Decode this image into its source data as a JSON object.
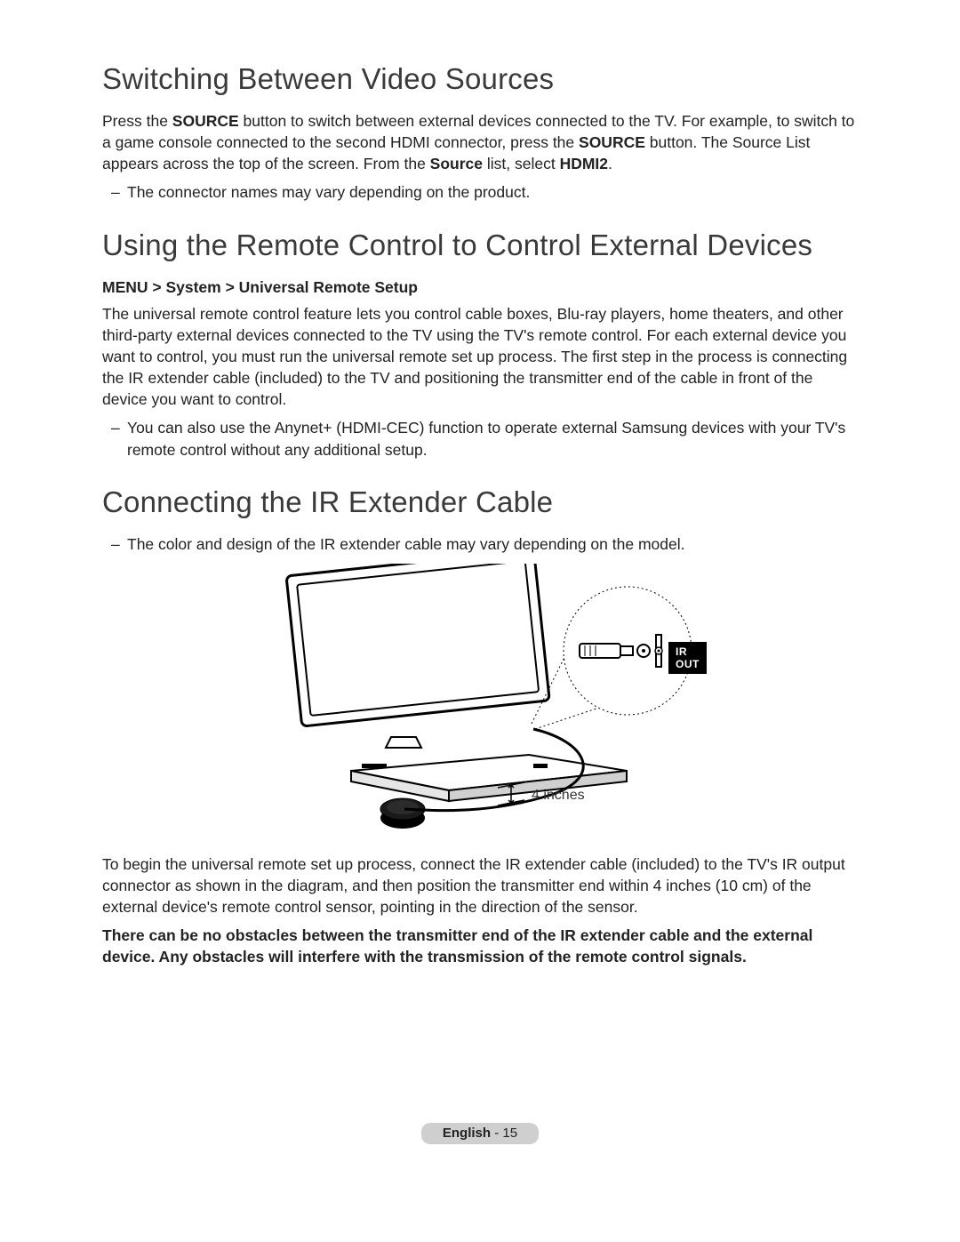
{
  "section1": {
    "heading": "Switching Between Video Sources",
    "para_pre": "Press the ",
    "para_bold1": "SOURCE",
    "para_mid1": " button to switch between external devices connected to the TV. For example, to switch to a game console connected to the second HDMI connector, press the ",
    "para_bold2": "SOURCE",
    "para_mid2": " button. The Source List appears across the top of the screen. From the ",
    "para_bold3": "Source",
    "para_mid3": " list, select ",
    "para_bold4": "HDMI2",
    "para_end": ".",
    "note1": "The connector names may vary depending on the product."
  },
  "section2": {
    "heading": "Using the Remote Control to Control External Devices",
    "menu_path": "MENU > System > Universal Remote Setup",
    "para": "The universal remote control feature lets you control cable boxes, Blu-ray players, home theaters, and other third-party external devices connected to the TV using the TV's remote control. For each external device you want to control, you must run the universal remote set up process. The first step in the process is connecting the IR extender cable (included) to the TV and positioning the transmitter end of the cable in front of the device you want to control.",
    "note1": "You can also use the Anynet+ (HDMI-CEC) function to operate external Samsung devices with your TV's remote control without any additional setup."
  },
  "section3": {
    "heading": "Connecting the IR Extender Cable",
    "note1": "The color and design of the IR extender cable may vary depending on the model.",
    "diagram": {
      "ir_out_label": "IR OUT",
      "distance_label": "4 inches"
    },
    "para2": "To begin the universal remote set up process, connect the IR extender cable (included) to the TV's IR output connector as shown in the diagram, and then position the transmitter end within 4 inches (10 cm) of the external device's remote control sensor, pointing in the direction of the sensor.",
    "warn": "There can be no obstacles between the transmitter end of the IR extender cable and the external device. Any obstacles will interfere with the transmission of the remote control signals."
  },
  "footer": {
    "language": "English",
    "sep": " - ",
    "pagenum": "15"
  }
}
